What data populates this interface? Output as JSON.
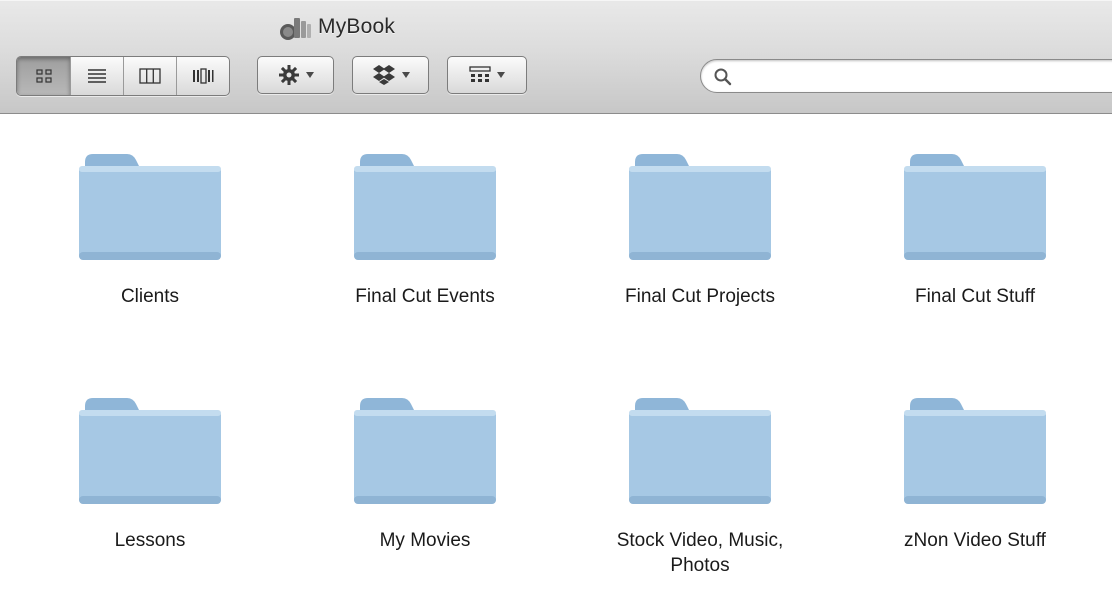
{
  "window": {
    "title": "MyBook"
  },
  "toolbar": {
    "view_buttons": [
      {
        "name": "icon-view",
        "icon": "icon-grid-icon",
        "active": true
      },
      {
        "name": "list-view",
        "icon": "list-icon",
        "active": false
      },
      {
        "name": "column-view",
        "icon": "columns-icon",
        "active": false
      },
      {
        "name": "coverflow-view",
        "icon": "coverflow-icon",
        "active": false
      }
    ],
    "action_button": {
      "icon": "gear-icon"
    },
    "dropbox_button": {
      "icon": "dropbox-icon"
    },
    "arrange_button": {
      "icon": "arrange-icon"
    },
    "search": {
      "placeholder": "",
      "value": ""
    }
  },
  "colors": {
    "folder_body": "#a6c8e4",
    "folder_tab": "#8fb6d8",
    "toolbar_top": "#e9e9e9",
    "toolbar_bottom": "#c7c7c7"
  },
  "folders": [
    {
      "label": "Clients"
    },
    {
      "label": "Final Cut Events"
    },
    {
      "label": "Final Cut Projects"
    },
    {
      "label": "Final Cut Stuff"
    },
    {
      "label": "Lessons"
    },
    {
      "label": "My Movies"
    },
    {
      "label": "Stock Video, Music, Photos"
    },
    {
      "label": "zNon Video Stuff"
    }
  ]
}
